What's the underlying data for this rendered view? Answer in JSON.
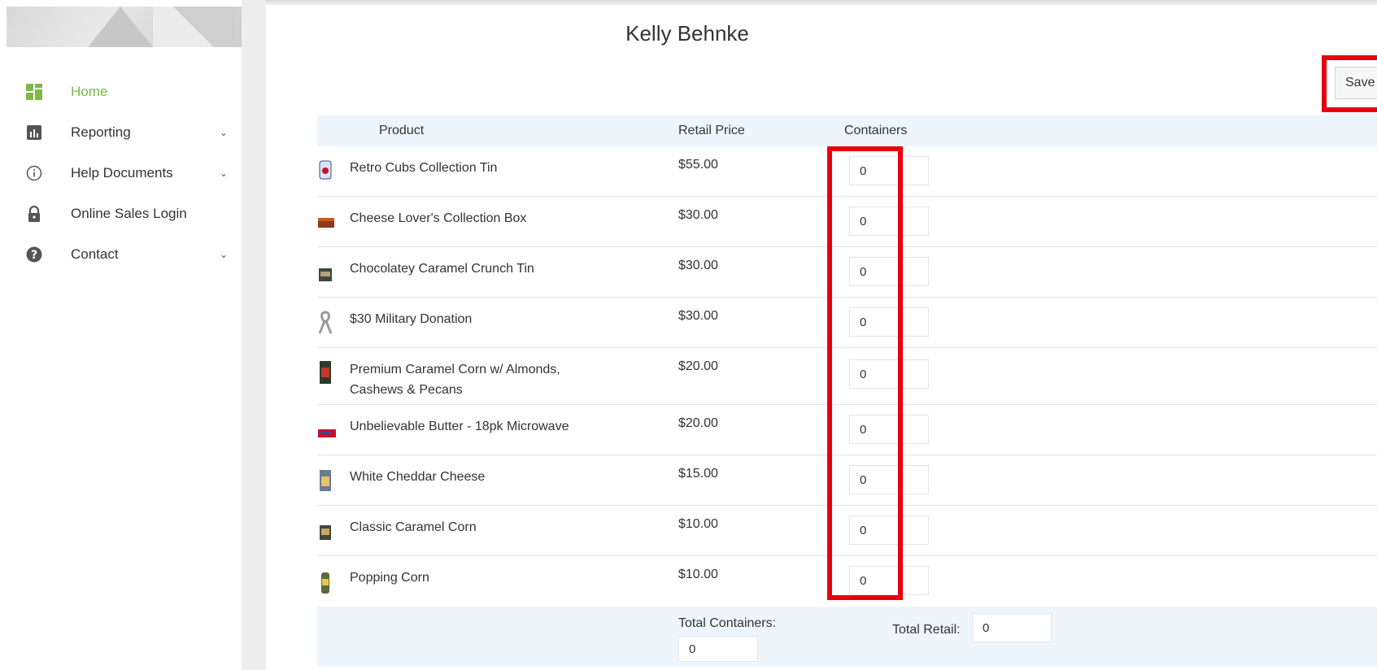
{
  "sidebar": {
    "items": [
      {
        "label": "Home",
        "icon": "dashboard-grid-icon",
        "active": true,
        "has_submenu": false
      },
      {
        "label": "Reporting",
        "icon": "bar-chart-icon",
        "active": false,
        "has_submenu": true
      },
      {
        "label": "Help Documents",
        "icon": "info-circle-icon",
        "active": false,
        "has_submenu": true
      },
      {
        "label": "Online Sales Login",
        "icon": "lock-icon",
        "active": false,
        "has_submenu": false
      },
      {
        "label": "Contact",
        "icon": "question-circle-icon",
        "active": false,
        "has_submenu": true
      }
    ],
    "accent_color": "#7db944"
  },
  "main": {
    "title": "Kelly Behnke",
    "save_label": "Save",
    "table": {
      "headers": {
        "product": "Product",
        "retail_price": "Retail Price",
        "containers": "Containers"
      },
      "rows": [
        {
          "product": "Retro Cubs Collection Tin",
          "price": "$55.00",
          "containers": "0"
        },
        {
          "product": "Cheese Lover's Collection Box",
          "price": "$30.00",
          "containers": "0"
        },
        {
          "product": "Chocolatey Caramel Crunch Tin",
          "price": "$30.00",
          "containers": "0"
        },
        {
          "product": "$30 Military Donation",
          "price": "$30.00",
          "containers": "0"
        },
        {
          "product": "Premium Caramel Corn w/ Almonds, Cashews & Pecans",
          "price": "$20.00",
          "containers": "0"
        },
        {
          "product": "Unbelievable Butter - 18pk Microwave",
          "price": "$20.00",
          "containers": "0"
        },
        {
          "product": "White Cheddar Cheese",
          "price": "$15.00",
          "containers": "0"
        },
        {
          "product": "Classic Caramel Corn",
          "price": "$10.00",
          "containers": "0"
        },
        {
          "product": "Popping Corn",
          "price": "$10.00",
          "containers": "0"
        }
      ]
    },
    "totals": {
      "containers_label": "Total Containers:",
      "containers_value": "0",
      "retail_label": "Total Retail:",
      "retail_value": "0"
    },
    "highlight_color": "#e8000e"
  }
}
